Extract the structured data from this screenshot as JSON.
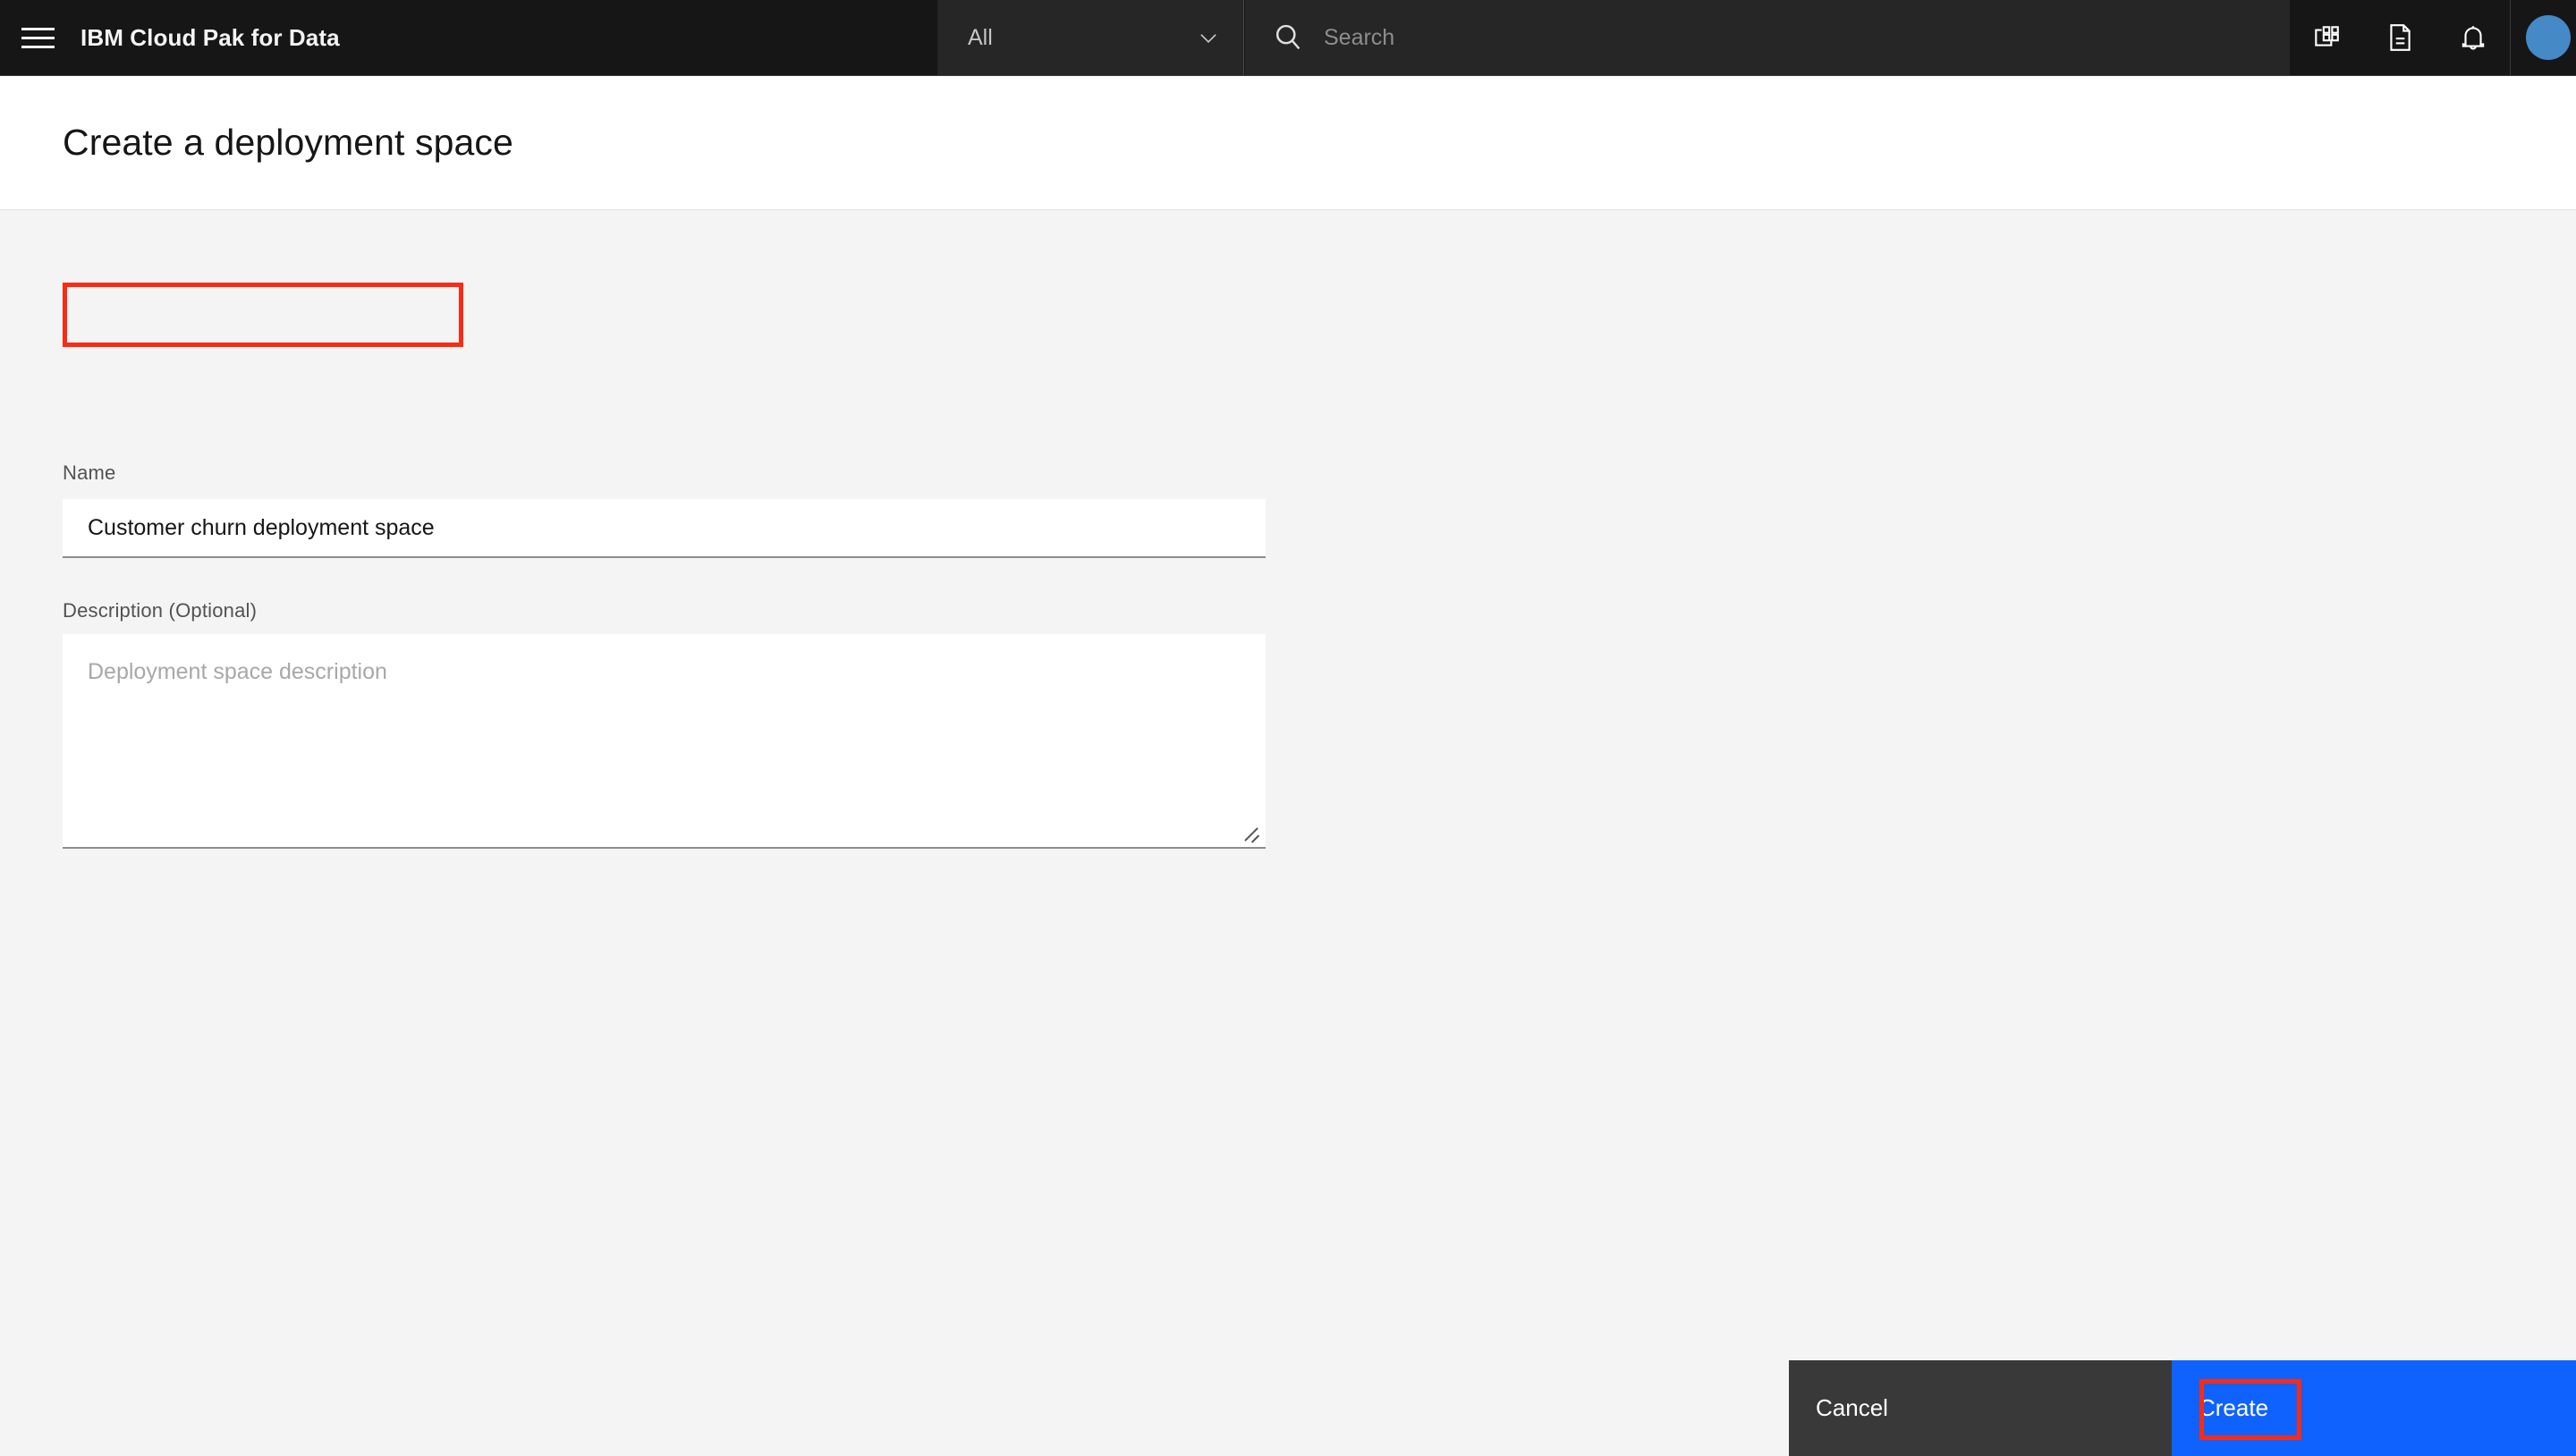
{
  "header": {
    "menu_icon": "hamburger-menu-icon",
    "brand": "IBM Cloud Pak for Data",
    "scope": {
      "value": "All",
      "chevron_icon": "chevron-down-icon"
    },
    "search": {
      "icon": "search-icon",
      "value": "",
      "placeholder": "Search"
    },
    "actions": [
      {
        "name": "app-switcher-icon",
        "label": "App switcher"
      },
      {
        "name": "document-icon",
        "label": "Docs"
      },
      {
        "name": "notification-bell-icon",
        "label": "Notifications"
      }
    ],
    "avatar": "user-avatar"
  },
  "page": {
    "title": "Create a deployment space"
  },
  "form": {
    "name": {
      "label": "Name",
      "value": "Customer churn deployment space",
      "placeholder": ""
    },
    "description": {
      "label": "Description (Optional)",
      "value": "",
      "placeholder": "Deployment space description"
    }
  },
  "actions": {
    "cancel_label": "Cancel",
    "create_label": "Create"
  },
  "colors": {
    "header_bg": "#161616",
    "field_bg": "#262626",
    "page_bg": "#f4f4f4",
    "primary_button": "#0f62fe",
    "secondary_button": "#393939",
    "highlight": "#fa2b15",
    "avatar": "#4589c7"
  }
}
